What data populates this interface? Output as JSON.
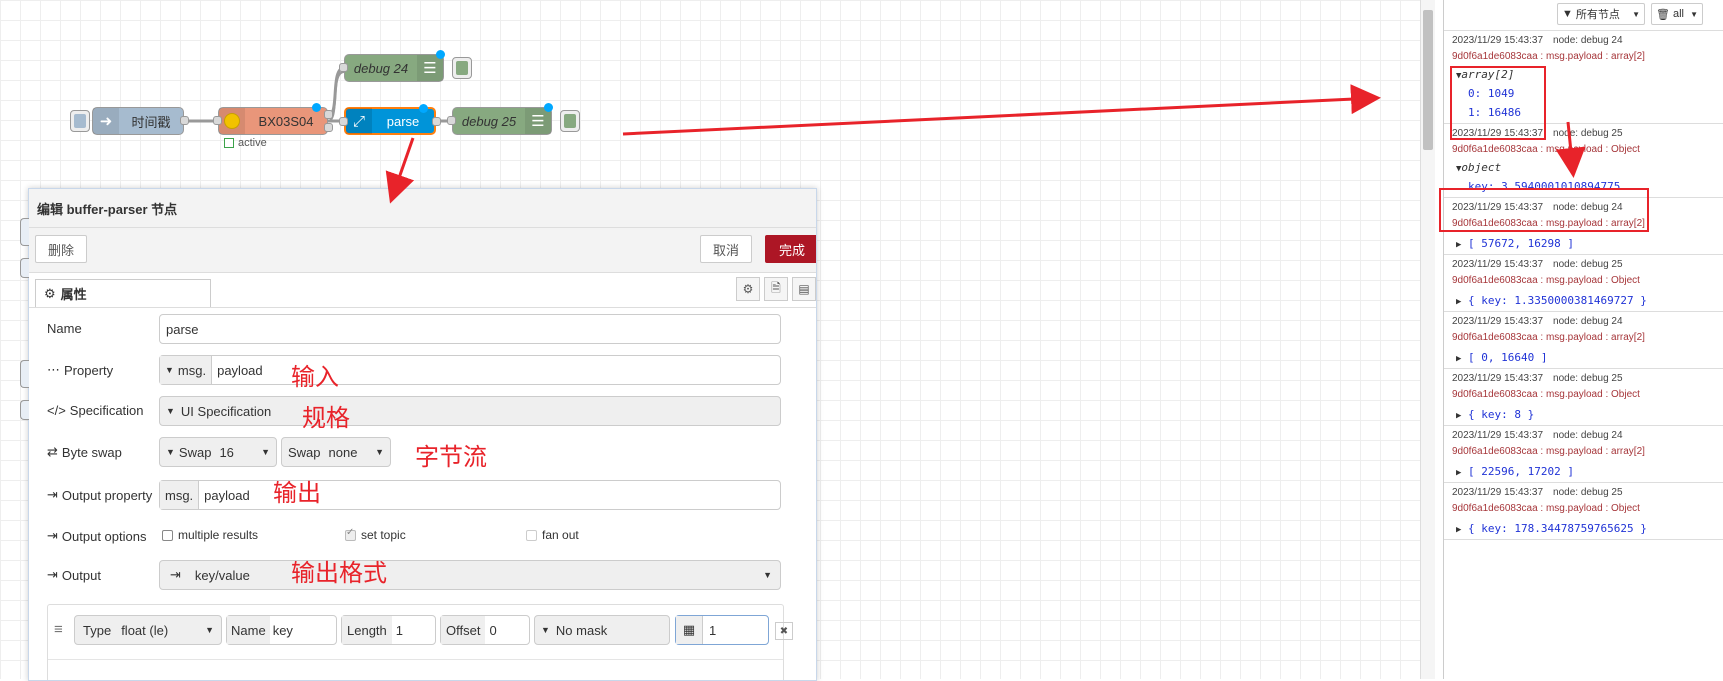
{
  "flow": {
    "nodes": {
      "inject_label": "时间戳",
      "modbus_label": "BX03S04",
      "modbus_status": "active",
      "parse_label": "parse",
      "debug24_label": "debug 24",
      "debug25_label": "debug 25"
    }
  },
  "editor": {
    "title": "编辑 buffer-parser 节点",
    "delete_label": "删除",
    "cancel_label": "取消",
    "done_label": "完成",
    "tab_properties": "属性",
    "name_label": "Name",
    "name_value": "parse",
    "property_label": "Property",
    "property_prefix": "msg.",
    "property_value": "payload",
    "spec_label": "Specification",
    "spec_value": "UI Specification",
    "byteswap_label": "Byte swap",
    "swap1_prefix": "Swap",
    "swap1_value": "16",
    "swap2_prefix": "Swap",
    "swap2_value": "none",
    "output_property_label": "Output property",
    "output_property_prefix": "msg.",
    "output_property_value": "payload",
    "output_options_label": "Output options",
    "opt_multiple": "multiple results",
    "opt_set_topic": "set topic",
    "opt_fan_out": "fan out",
    "output_label": "Output",
    "output_value": "key/value",
    "item": {
      "type_label": "Type",
      "type_value": "float (le)",
      "name_label": "Name",
      "name_value": "key",
      "length_label": "Length",
      "length_value": "1",
      "offset_label": "Offset",
      "offset_value": "0",
      "mask_value": "No mask",
      "scale_value": "1"
    }
  },
  "annotations": {
    "input": "输入",
    "spec": "规格",
    "byte_stream": "字节流",
    "output": "输出",
    "output_format": "输出格式"
  },
  "sidebar": {
    "filter_label": "所有节点",
    "clear_label": "all",
    "messages": [
      {
        "time": "2023/11/29 15:43:37",
        "node": "node: debug 24",
        "topic": "9d0f6a1de6083caa : msg.payload : array[2]",
        "kind": "array-expanded",
        "head": "array[2]",
        "lines": [
          "0: 1049",
          "1: 16486"
        ]
      },
      {
        "time": "2023/11/29 15:43:37",
        "node": "node: debug 25",
        "topic": "9d0f6a1de6083caa : msg.payload : Object",
        "kind": "object-expanded",
        "head": "object",
        "lines": [
          "key: 3.5940001010894775"
        ]
      },
      {
        "time": "2023/11/29 15:43:37",
        "node": "node: debug 24",
        "topic": "9d0f6a1de6083caa : msg.payload : array[2]",
        "kind": "collapsed",
        "value": "[ 57672, 16298 ]"
      },
      {
        "time": "2023/11/29 15:43:37",
        "node": "node: debug 25",
        "topic": "9d0f6a1de6083caa : msg.payload : Object",
        "kind": "collapsed",
        "value": "{ key: 1.3350000381469727 }"
      },
      {
        "time": "2023/11/29 15:43:37",
        "node": "node: debug 24",
        "topic": "9d0f6a1de6083caa : msg.payload : array[2]",
        "kind": "collapsed",
        "value": "[ 0, 16640 ]"
      },
      {
        "time": "2023/11/29 15:43:37",
        "node": "node: debug 25",
        "topic": "9d0f6a1de6083caa : msg.payload : Object",
        "kind": "collapsed",
        "value": "{ key: 8 }"
      },
      {
        "time": "2023/11/29 15:43:37",
        "node": "node: debug 24",
        "topic": "9d0f6a1de6083caa : msg.payload : array[2]",
        "kind": "collapsed",
        "value": "[ 22596, 17202 ]"
      },
      {
        "time": "2023/11/29 15:43:37",
        "node": "node: debug 25",
        "topic": "9d0f6a1de6083caa : msg.payload : Object",
        "kind": "collapsed",
        "value": "{ key: 178.34478759765625 }"
      }
    ]
  },
  "colors": {
    "accent_red": "#e8232a",
    "done_button": "#ad1625",
    "parse_node": "#0094d9",
    "modbus_node": "#e9967a",
    "debug_node": "#87a980",
    "inject_node": "#a6bbcf"
  }
}
